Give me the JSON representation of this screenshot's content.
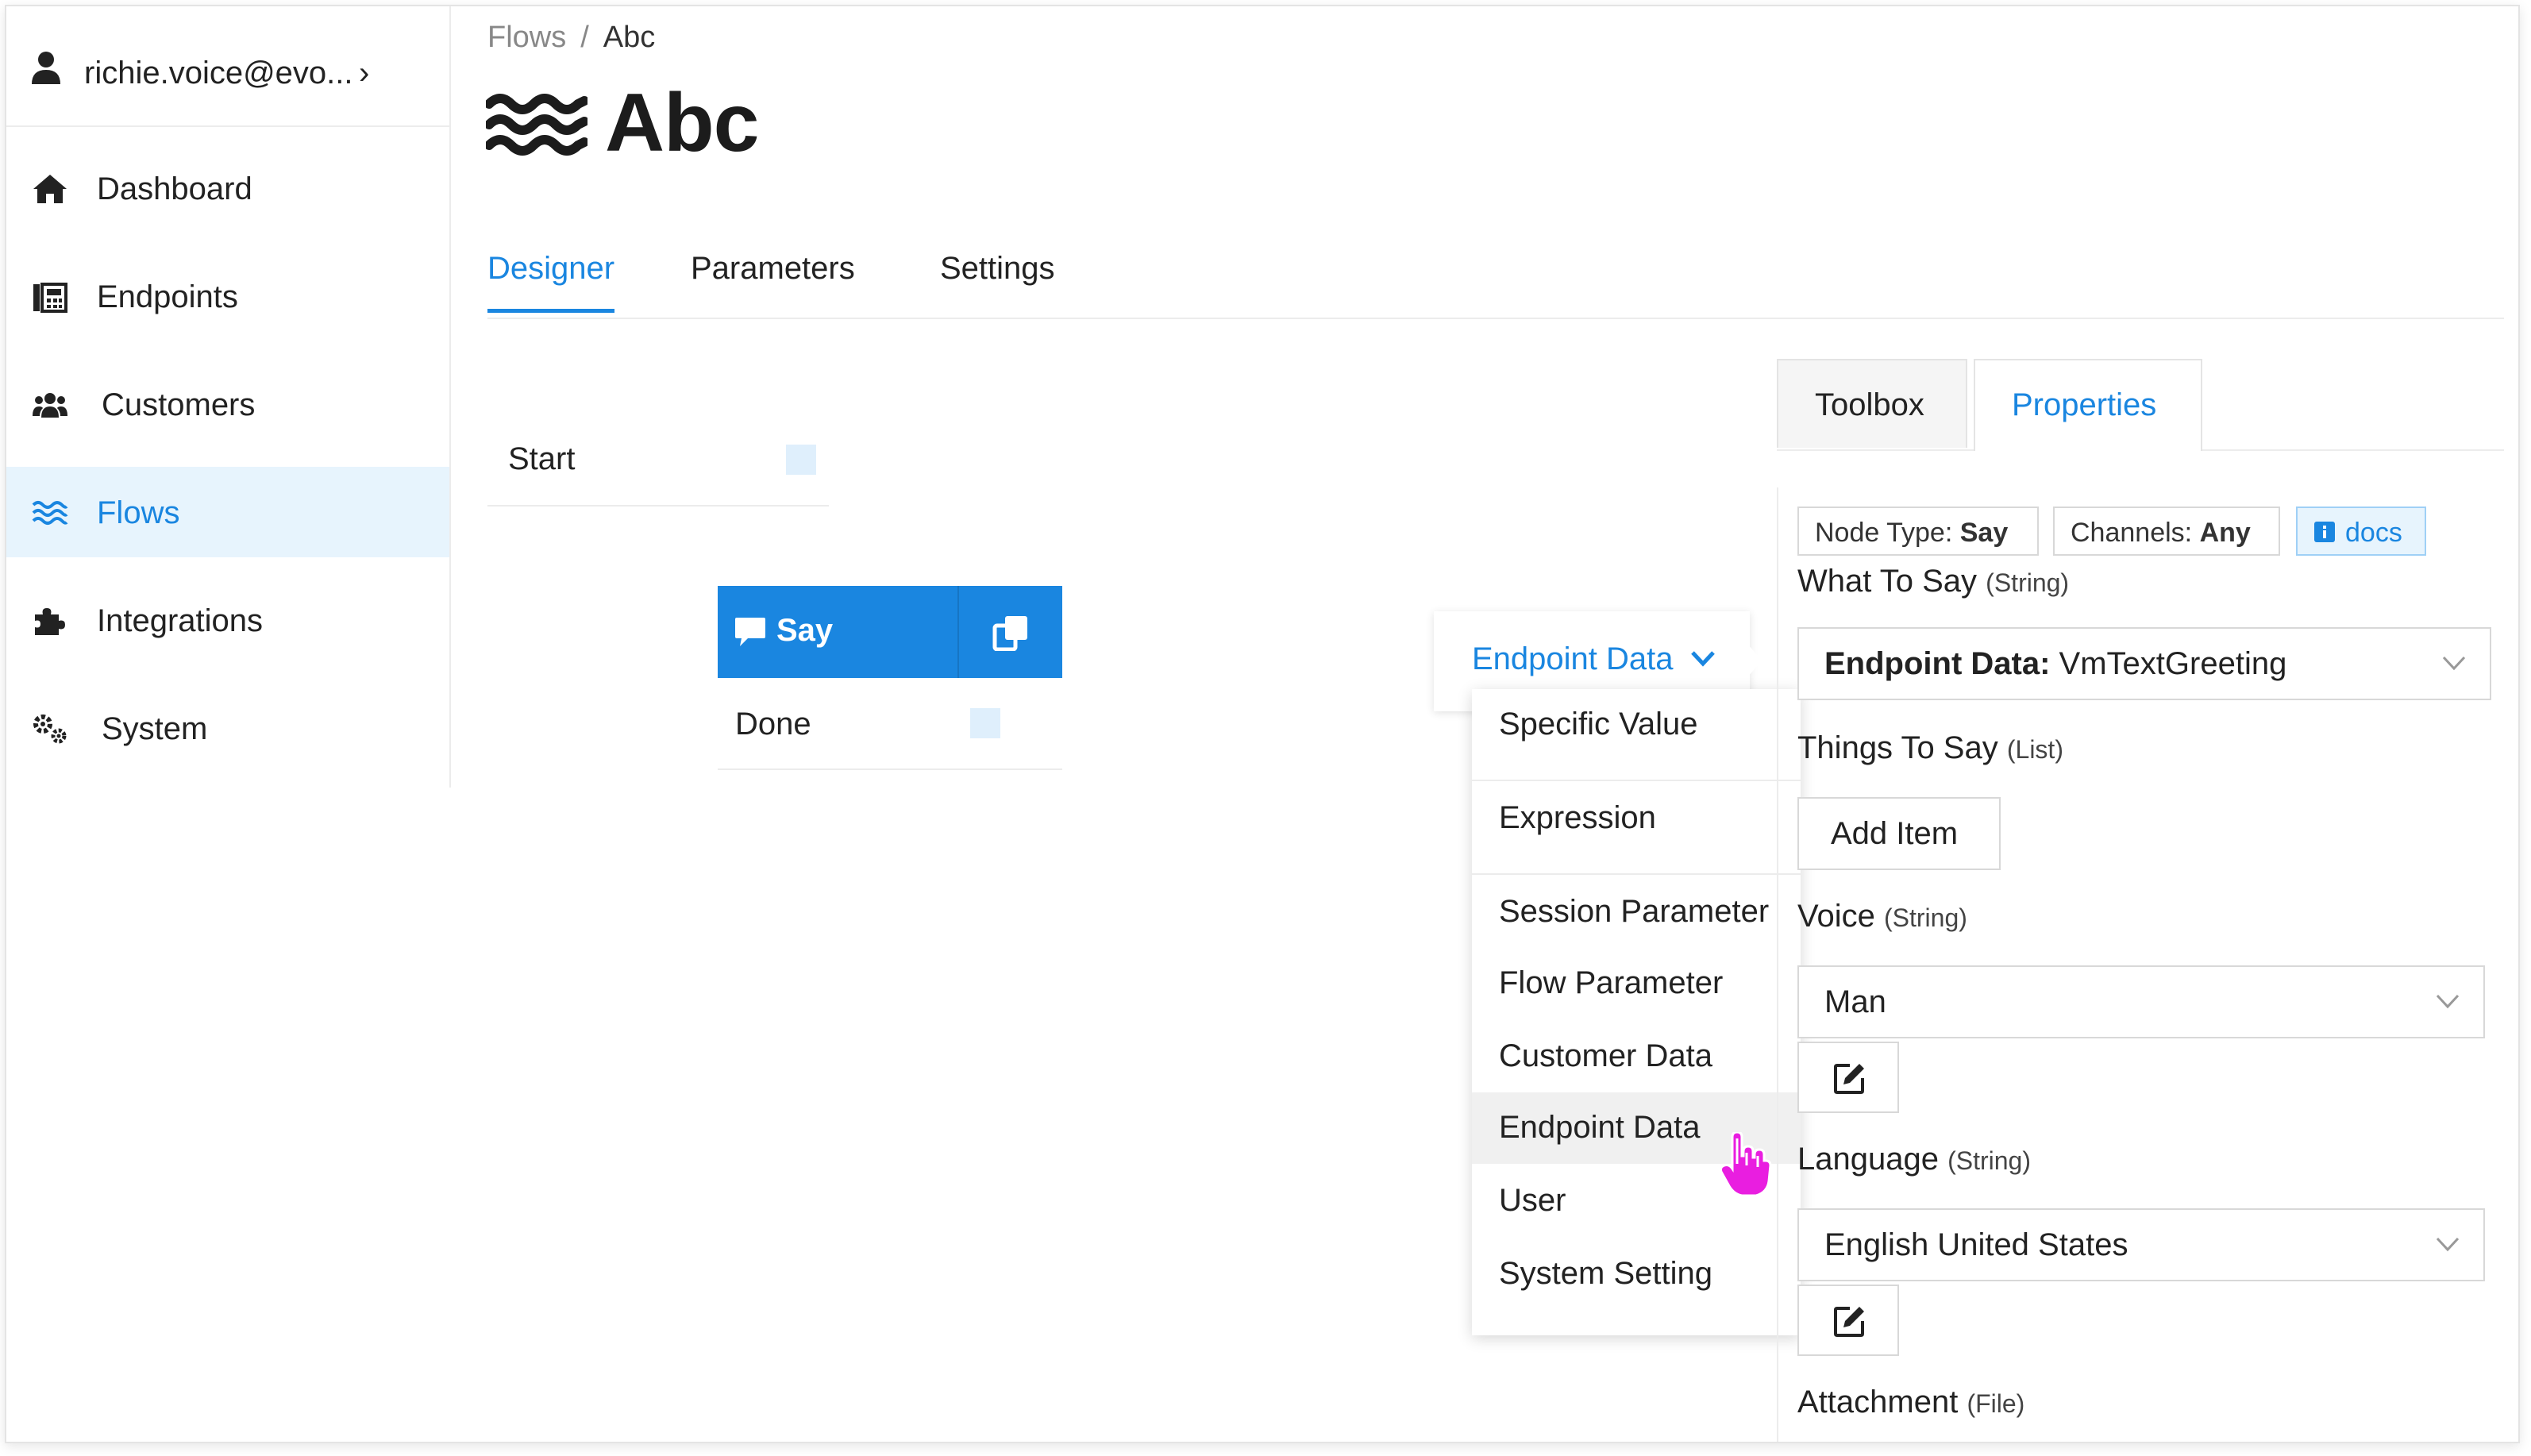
{
  "sidebar": {
    "user": {
      "email": "richie.voice@evo...",
      "chevron": "›"
    },
    "items": [
      {
        "label": "Dashboard",
        "icon": "home-icon"
      },
      {
        "label": "Endpoints",
        "icon": "fax-icon"
      },
      {
        "label": "Customers",
        "icon": "users-icon"
      },
      {
        "label": "Flows",
        "icon": "water-icon",
        "active": true
      },
      {
        "label": "Integrations",
        "icon": "puzzle-icon"
      },
      {
        "label": "System",
        "icon": "gears-icon"
      }
    ]
  },
  "breadcrumb": {
    "parent": "Flows",
    "separator": "/",
    "current": "Abc"
  },
  "page": {
    "title": "Abc"
  },
  "tabs": [
    {
      "label": "Designer",
      "active": true
    },
    {
      "label": "Parameters"
    },
    {
      "label": "Settings"
    }
  ],
  "canvas": {
    "start_node": {
      "label": "Start"
    },
    "say_node": {
      "label": "Say",
      "output": "Done"
    }
  },
  "value_source": {
    "selected": "Endpoint Data",
    "options": [
      "Specific Value",
      "Expression",
      "Session Parameter",
      "Flow Parameter",
      "Customer Data",
      "Endpoint Data",
      "User",
      "System Setting"
    ],
    "hovered": "Endpoint Data"
  },
  "right_panel": {
    "tabs": [
      {
        "label": "Toolbox"
      },
      {
        "label": "Properties",
        "active": true
      }
    ],
    "badges": {
      "node_type_label": "Node Type:",
      "node_type_value": "Say",
      "channels_label": "Channels:",
      "channels_value": "Any",
      "docs": "docs"
    },
    "fields": {
      "what_to_say": {
        "label": "What To Say",
        "type": "(String)",
        "value_prefix": "Endpoint Data:",
        "value": "VmTextGreeting"
      },
      "things_to_say": {
        "label": "Things To Say",
        "type": "(List)",
        "button": "Add Item"
      },
      "voice": {
        "label": "Voice",
        "type": "(String)",
        "value": "Man"
      },
      "language": {
        "label": "Language",
        "type": "(String)",
        "value": "English United States"
      },
      "attachment": {
        "label": "Attachment",
        "type": "(File)"
      }
    }
  },
  "colors": {
    "accent": "#1a86e0",
    "active_bg": "#e7f4fd",
    "cursor": "#e91ee0"
  }
}
